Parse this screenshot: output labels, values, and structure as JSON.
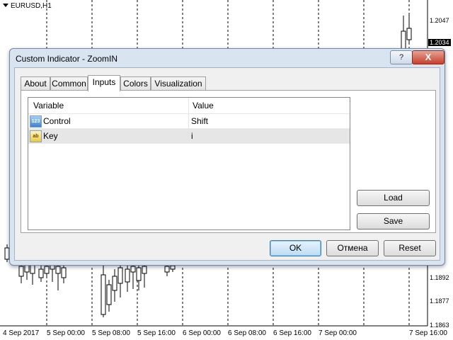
{
  "chart": {
    "symbol": "EURUSD,H1",
    "prices": [
      "1.2047",
      "1.2034",
      "1.1892",
      "1.1877",
      "1.1863"
    ],
    "dates": [
      "4 Sep 2017",
      "5 Sep 00:00",
      "5 Sep 08:00",
      "5 Sep 16:00",
      "6 Sep 00:00",
      "6 Sep 08:00",
      "6 Sep 16:00",
      "7 Sep 00:00",
      "7 Sep 16:00"
    ],
    "colors": {
      "grid": "#000000",
      "candle": "#000000"
    }
  },
  "dialog": {
    "title": "Custom Indicator - ZoomIN",
    "help_label": "?",
    "close_label": "X",
    "tabs": [
      {
        "label": "About",
        "active": false
      },
      {
        "label": "Common",
        "active": false
      },
      {
        "label": "Inputs",
        "active": true
      },
      {
        "label": "Colors",
        "active": false
      },
      {
        "label": "Visualization",
        "active": false
      }
    ],
    "table": {
      "columns": [
        "Variable",
        "Value"
      ],
      "rows": [
        {
          "icon": "numeric-type-icon",
          "icon_text": "123",
          "variable": "Control",
          "value": "Shift",
          "selected": false
        },
        {
          "icon": "string-type-icon",
          "icon_text": "ab",
          "variable": "Key",
          "value": "i",
          "selected": true
        }
      ]
    },
    "side_buttons": {
      "load": "Load",
      "save": "Save"
    },
    "footer": {
      "ok": "OK",
      "cancel": "Отмена",
      "reset": "Reset"
    }
  }
}
